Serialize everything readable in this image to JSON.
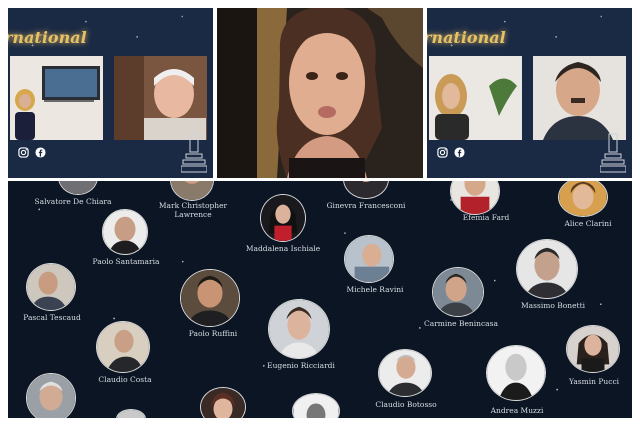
{
  "panels": [
    {
      "banner": "rnational",
      "icons": [
        "instagram-icon",
        "facebook-icon"
      ]
    },
    {
      "banner": "",
      "icons": []
    },
    {
      "banner": "rnational",
      "icons": [
        "instagram-icon",
        "facebook-icon"
      ]
    }
  ],
  "gallery": {
    "people": [
      {
        "name": "Salvatore De Chiara"
      },
      {
        "name": "Mark Christopher Lawrence"
      },
      {
        "name": "Ginevra Francesconi"
      },
      {
        "name": "Efemia Fard"
      },
      {
        "name": "Alice Clarini"
      },
      {
        "name": "Paolo Santamaria"
      },
      {
        "name": "Maddalena Ischiale"
      },
      {
        "name": "Michele Ravini"
      },
      {
        "name": "Massimo Bonetti"
      },
      {
        "name": "Pascal Tescaud"
      },
      {
        "name": "Paolo Ruffini"
      },
      {
        "name": "Carmine Benincasa"
      },
      {
        "name": "Eugenio Ricciardi"
      },
      {
        "name": "Claudio Costa"
      },
      {
        "name": "Claudio Botosso"
      },
      {
        "name": "Andrea Muzzi"
      },
      {
        "name": "Yasmin Pucci"
      }
    ]
  }
}
